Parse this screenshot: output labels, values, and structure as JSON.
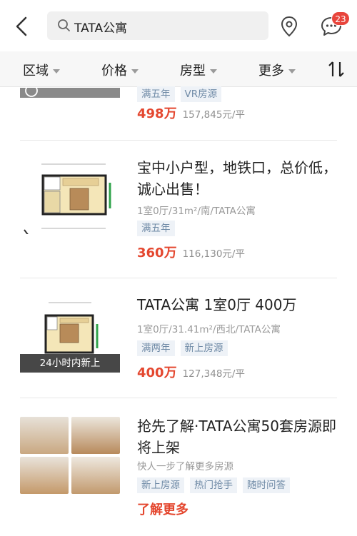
{
  "header": {
    "search_text": "TATA公寓",
    "notification_count": "23"
  },
  "filters": [
    {
      "label": "区域"
    },
    {
      "label": "价格"
    },
    {
      "label": "房型"
    },
    {
      "label": "更多"
    }
  ],
  "listings": [
    {
      "tags": [
        "满五年",
        "VR房源"
      ],
      "price": "498万",
      "unit_price": "157,845元/平"
    },
    {
      "title": "宝中小户型，地铁口，总价低，诚心出售！",
      "meta": "1室0厅/31m²/南/TATA公寓",
      "tags": [
        "满五年"
      ],
      "price": "360万",
      "unit_price": "116,130元/平"
    },
    {
      "title": "TATA公寓 1室0厅 400万",
      "meta": "1室0厅/31.41m²/西北/TATA公寓",
      "tags": [
        "满两年",
        "新上房源"
      ],
      "price": "400万",
      "unit_price": "127,348元/平",
      "badge": "24小时内新上"
    }
  ],
  "promo": {
    "title": "抢先了解·TATA公寓50套房源即将上架",
    "subtitle": "快人一步了解更多房源",
    "tags": [
      "新上房源",
      "热门抢手",
      "随时问答"
    ],
    "cta": "了解更多"
  },
  "colors": {
    "accent": "#e4472f",
    "badge": "#e8453c",
    "tag_bg": "#eef2f7",
    "tag_text": "#6f8aa6"
  },
  "icons": [
    "back-arrow-icon",
    "search-icon",
    "location-pin-icon",
    "message-icon",
    "sort-icon"
  ]
}
